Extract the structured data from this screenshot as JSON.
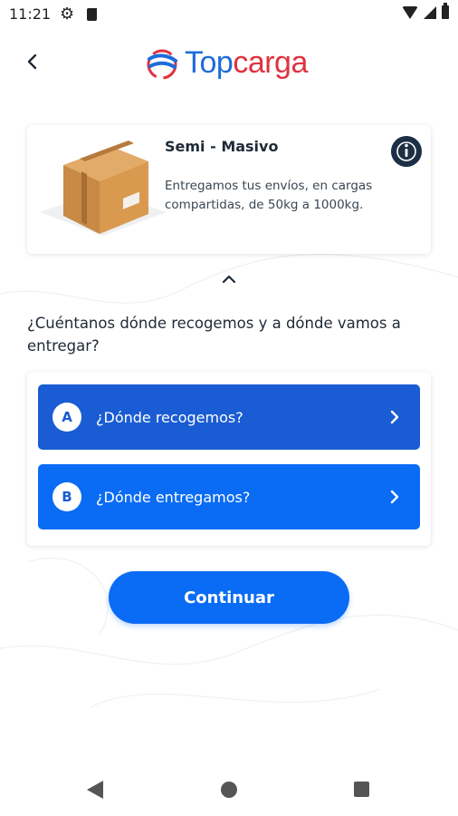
{
  "status_bar": {
    "time": "11:21"
  },
  "header": {
    "brand_top": "Top",
    "brand_carga": "carga"
  },
  "service": {
    "title": "Semi - Masivo",
    "description": "Entregamos tus envíos, en cargas compartidas, de 50kg a 1000kg."
  },
  "question": "¿Cuéntanos dónde recogemos y a dónde vamos a entregar?",
  "address": {
    "pickup": {
      "badge": "A",
      "label": "¿Dónde recogemos?"
    },
    "delivery": {
      "badge": "B",
      "label": "¿Dónde entregamos?"
    }
  },
  "continue_label": "Continuar",
  "colors": {
    "primary_dark": "#1a5cd3",
    "primary": "#0a6cf5",
    "brand_red": "#e0323f",
    "brand_blue": "#1e6cd9",
    "info_button": "#1d2f44"
  }
}
